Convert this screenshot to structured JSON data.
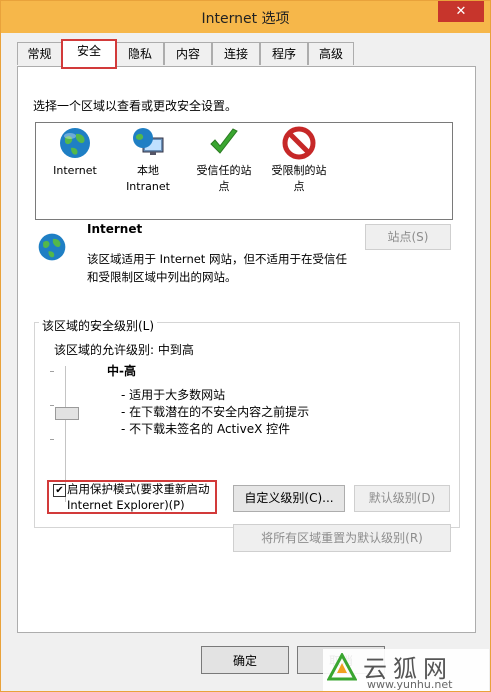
{
  "window": {
    "title": "Internet 选项",
    "close_symbol": "✕"
  },
  "tabs": [
    {
      "label": "常规"
    },
    {
      "label": "安全"
    },
    {
      "label": "隐私"
    },
    {
      "label": "内容"
    },
    {
      "label": "连接"
    },
    {
      "label": "程序"
    },
    {
      "label": "高级"
    }
  ],
  "security": {
    "zone_prompt": "选择一个区域以查看或更改安全设置。",
    "zones": [
      {
        "label": "Internet",
        "icon": "globe-icon"
      },
      {
        "label": "本地\nIntranet",
        "icon": "intranet-icon"
      },
      {
        "label": "受信任的站\n点",
        "icon": "trusted-check-icon"
      },
      {
        "label": "受限制的站\n点",
        "icon": "restricted-no-icon"
      }
    ],
    "selected_zone_name": "Internet",
    "selected_zone_desc_line1": "该区域适用于 Internet 网站，但不适用于在受信任",
    "selected_zone_desc_line2": "和受限制区域中列出的网站。",
    "sites_button": "站点(S)",
    "level_group_label": "该区域的安全级别(L)",
    "allowed_levels": "该区域的允许级别: 中到高",
    "level_name": "中-高",
    "level_bullets": [
      "- 适用于大多数网站",
      "- 在下载潜在的不安全内容之前提示",
      "- 不下载未签名的 ActiveX 控件"
    ],
    "protected_mode_line1": "启用保护模式(要求重新启动",
    "protected_mode_line2": "Internet Explorer)(P)",
    "protected_mode_checked": true,
    "check_mark": "✔",
    "custom_level_button": "自定义级别(C)...",
    "default_level_button": "默认级别(D)",
    "reset_all_button": "将所有区域重置为默认级别(R)"
  },
  "footer": {
    "ok_button": "确定",
    "cancel_button": "取消"
  },
  "watermark": {
    "brand": "云狐网",
    "url": "www.yunhu.net"
  }
}
